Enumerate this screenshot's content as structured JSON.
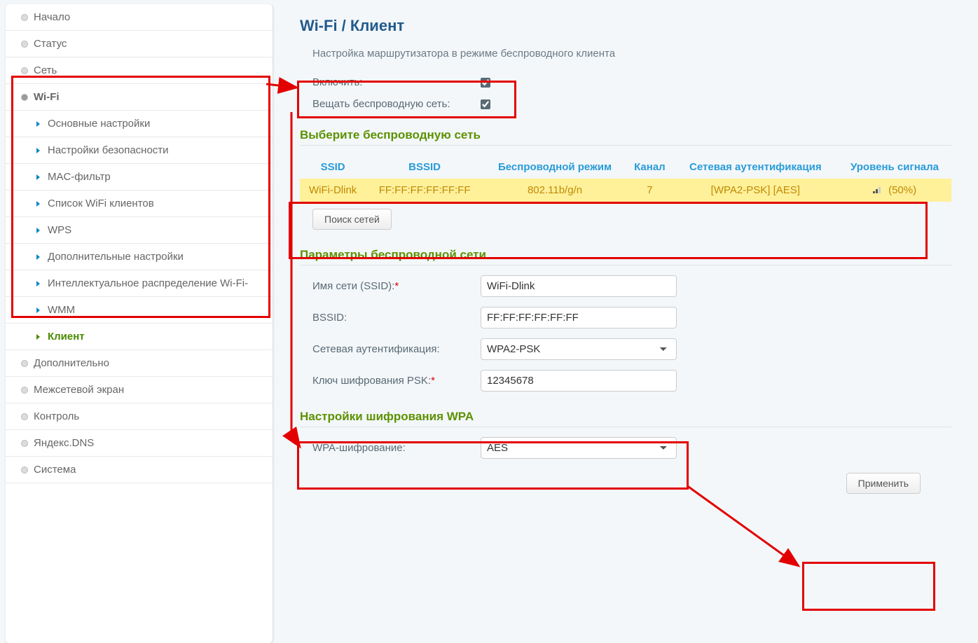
{
  "breadcrumb": {
    "part1": "Wi-Fi",
    "sep": " /  ",
    "part2": "Клиент"
  },
  "subtitle": "Настройка маршрутизатора в режиме беспроводного клиента",
  "sidebar": {
    "items": [
      {
        "label": "Начало"
      },
      {
        "label": "Статус"
      },
      {
        "label": "Сеть"
      },
      {
        "label": "Wi-Fi",
        "expanded": true,
        "children": [
          {
            "label": "Основные настройки"
          },
          {
            "label": "Настройки безопасности"
          },
          {
            "label": "MAC-фильтр"
          },
          {
            "label": "Список WiFi клиентов"
          },
          {
            "label": "WPS"
          },
          {
            "label": "Дополнительные настройки"
          },
          {
            "label": "Интеллектуальное распределение Wi-Fi-"
          },
          {
            "label": "WMM"
          },
          {
            "label": "Клиент",
            "active": true
          }
        ]
      },
      {
        "label": "Дополнительно"
      },
      {
        "label": "Межсетевой экран"
      },
      {
        "label": "Контроль"
      },
      {
        "label": "Яндекс.DNS"
      },
      {
        "label": "Система"
      }
    ]
  },
  "labels": {
    "enable": "Включить:",
    "broadcast": "Вещать беспроводную сеть:",
    "select_net": "Выберите беспроводную сеть",
    "search_btn": "Поиск сетей",
    "params": "Параметры беспроводной сети",
    "ssid_label": "Имя сети (SSID):",
    "bssid_label": "BSSID:",
    "auth_label": "Сетевая аутентификация:",
    "psk_label": "Ключ шифрования PSK:",
    "wpa_section": "Настройки шифрования WPA",
    "wpa_enc": "WPA-шифрование:",
    "apply": "Применить"
  },
  "table": {
    "headers": {
      "ssid": "SSID",
      "bssid": "BSSID",
      "mode": "Беспроводной режим",
      "channel": "Канал",
      "auth": "Сетевая аутентификация",
      "signal": "Уровень сигнала"
    },
    "row": {
      "ssid": "WiFi-Dlink",
      "bssid": "FF:FF:FF:FF:FF:FF",
      "mode": "802.11b/g/n",
      "channel": "7",
      "auth": "[WPA2-PSK] [AES]",
      "signal": "(50%)"
    }
  },
  "form": {
    "ssid": "WiFi-Dlink",
    "bssid": "FF:FF:FF:FF:FF:FF",
    "auth": "WPA2-PSK",
    "psk": "12345678",
    "wpa_enc": "AES"
  }
}
